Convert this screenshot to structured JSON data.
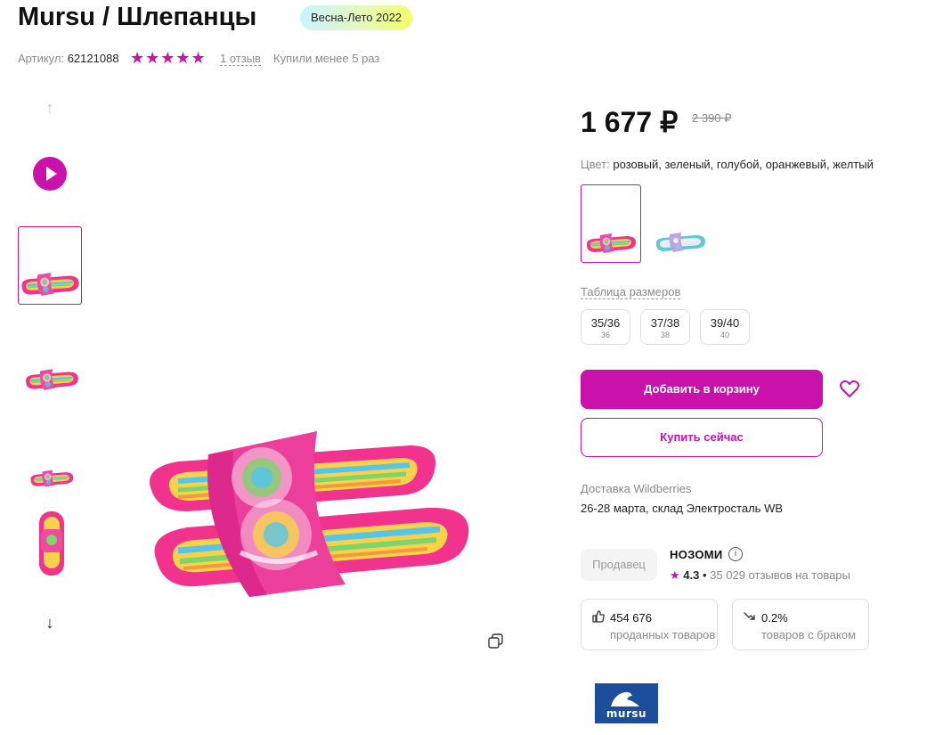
{
  "product": {
    "title": "Mursu / Шлепанцы",
    "season_badge": "Весна-Лето 2022",
    "article_label": "Артикул:",
    "article_value": "62121088",
    "rating_stars": 5,
    "stars_text": "★★★★★",
    "reviews_link": "1 отзыв",
    "bought_text": "Купили менее 5 раз"
  },
  "gallery": {
    "up_arrow": "↑",
    "down_arrow": "↓"
  },
  "price": {
    "current": "1 677 ₽",
    "old": "2 390 ₽"
  },
  "color": {
    "label": "Цвет:",
    "value": "розовый, зеленый, голубой, оранжевый, желтый"
  },
  "sizes": {
    "table_link": "Таблица размеров",
    "items": [
      {
        "label": "35/36",
        "ru": "36"
      },
      {
        "label": "37/38",
        "ru": "38"
      },
      {
        "label": "39/40",
        "ru": "40"
      }
    ]
  },
  "actions": {
    "add_to_cart": "Добавить в корзину",
    "buy_now": "Купить сейчас"
  },
  "delivery": {
    "label": "Доставка Wildberries",
    "value": "26-28 марта, склад Электросталь WB"
  },
  "seller": {
    "chip": "Продавец",
    "name": "НОЗОМИ",
    "info_icon": "i",
    "star": "★",
    "rating": "4.3",
    "separator": "•",
    "reviews": "35 029 отзывов на товары",
    "stats": [
      {
        "icon": "thumbs-up-icon",
        "value": "454 676",
        "label": "проданных товаров"
      },
      {
        "icon": "trend-down-icon",
        "value": "0.2%",
        "label": "товаров с браком"
      }
    ]
  },
  "brand_logo_text": "mursu",
  "colors": {
    "accent": "#cb11ab",
    "muted": "#8a8a8a",
    "slipper_pink": "#f2338e",
    "logo_blue": "#1c4e9c"
  }
}
